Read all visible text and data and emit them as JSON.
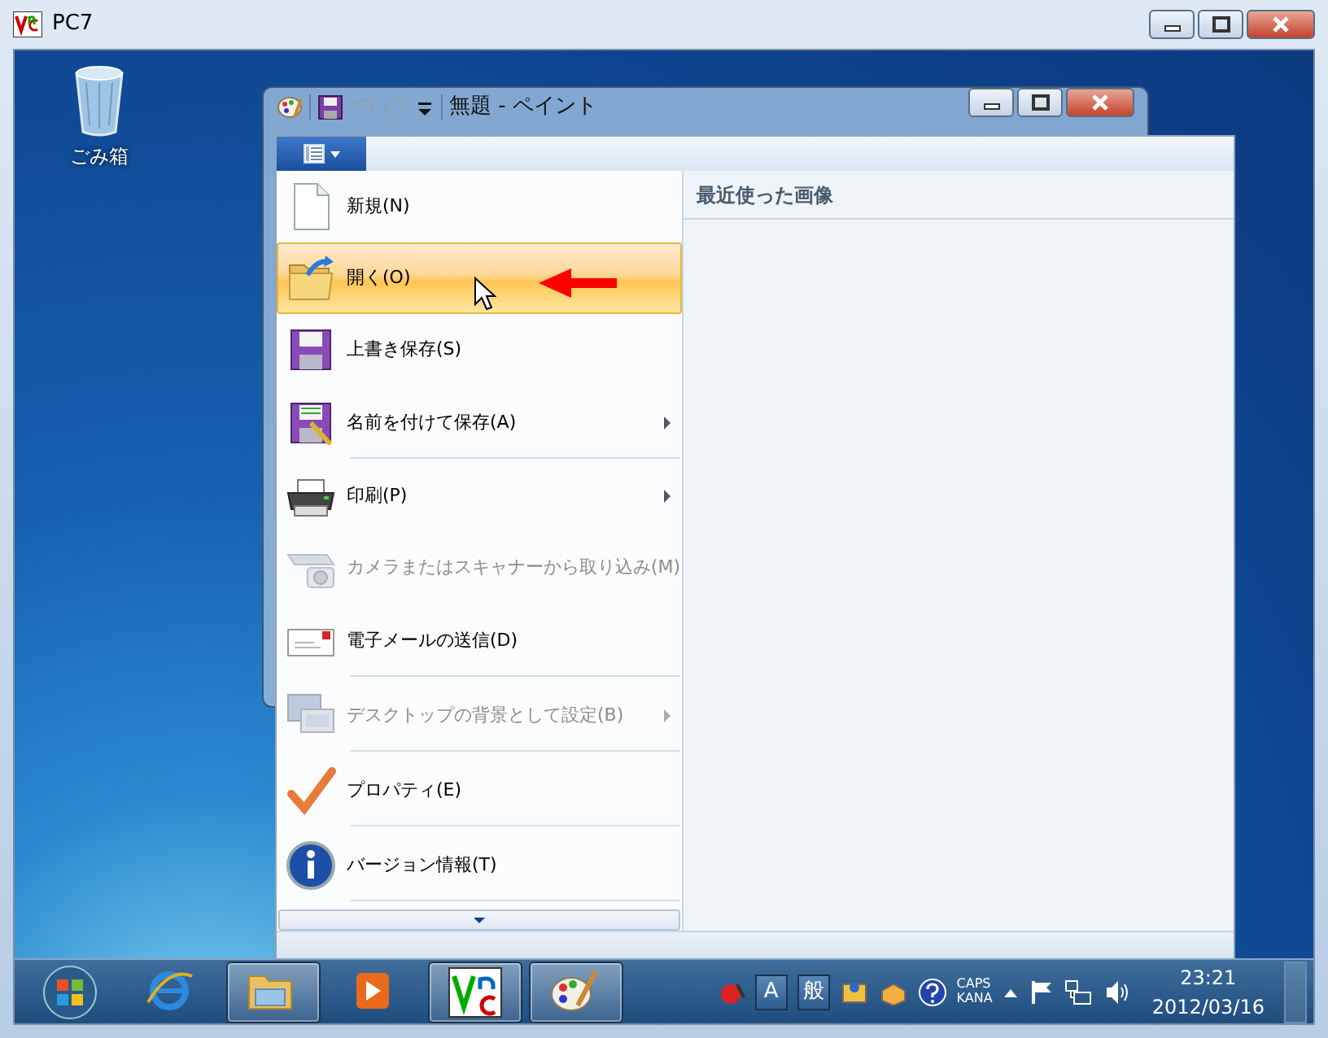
{
  "window": {
    "title": "PC7"
  },
  "desktop_icons": [
    {
      "label": "ごみ箱"
    }
  ],
  "paint_window": {
    "title": "無題 - ペイント"
  },
  "app_menu": {
    "items": [
      {
        "label": "新規(N)",
        "selected": false,
        "disabled": false,
        "submenu": false,
        "separator_after": false
      },
      {
        "label": "開く(O)",
        "selected": true,
        "disabled": false,
        "submenu": false,
        "separator_after": false
      },
      {
        "label": "上書き保存(S)",
        "selected": false,
        "disabled": false,
        "submenu": false,
        "separator_after": false
      },
      {
        "label": "名前を付けて保存(A)",
        "selected": false,
        "disabled": false,
        "submenu": true,
        "separator_after": true
      },
      {
        "label": "印刷(P)",
        "selected": false,
        "disabled": false,
        "submenu": true,
        "separator_after": false
      },
      {
        "label": "カメラまたはスキャナーから取り込み(M)",
        "selected": false,
        "disabled": true,
        "submenu": false,
        "separator_after": false
      },
      {
        "label": "電子メールの送信(D)",
        "selected": false,
        "disabled": false,
        "submenu": false,
        "separator_after": true
      },
      {
        "label": "デスクトップの背景として設定(B)",
        "selected": false,
        "disabled": true,
        "submenu": true,
        "separator_after": true
      },
      {
        "label": "プロパティ(E)",
        "selected": false,
        "disabled": false,
        "submenu": false,
        "separator_after": true
      },
      {
        "label": "バージョン情報(T)",
        "selected": false,
        "disabled": false,
        "submenu": false,
        "separator_after": true
      }
    ],
    "recent": {
      "heading": "最近使った画像"
    }
  },
  "taskbar": {
    "buttons": [
      {
        "running": false
      },
      {
        "running": true
      },
      {
        "running": false
      },
      {
        "running": true
      },
      {
        "running": true
      }
    ],
    "language_bar": [
      "A",
      "般"
    ],
    "indicators": [
      "CAPS",
      "KANA"
    ],
    "clock": {
      "time": "23:21",
      "date": "2012/03/16"
    }
  }
}
